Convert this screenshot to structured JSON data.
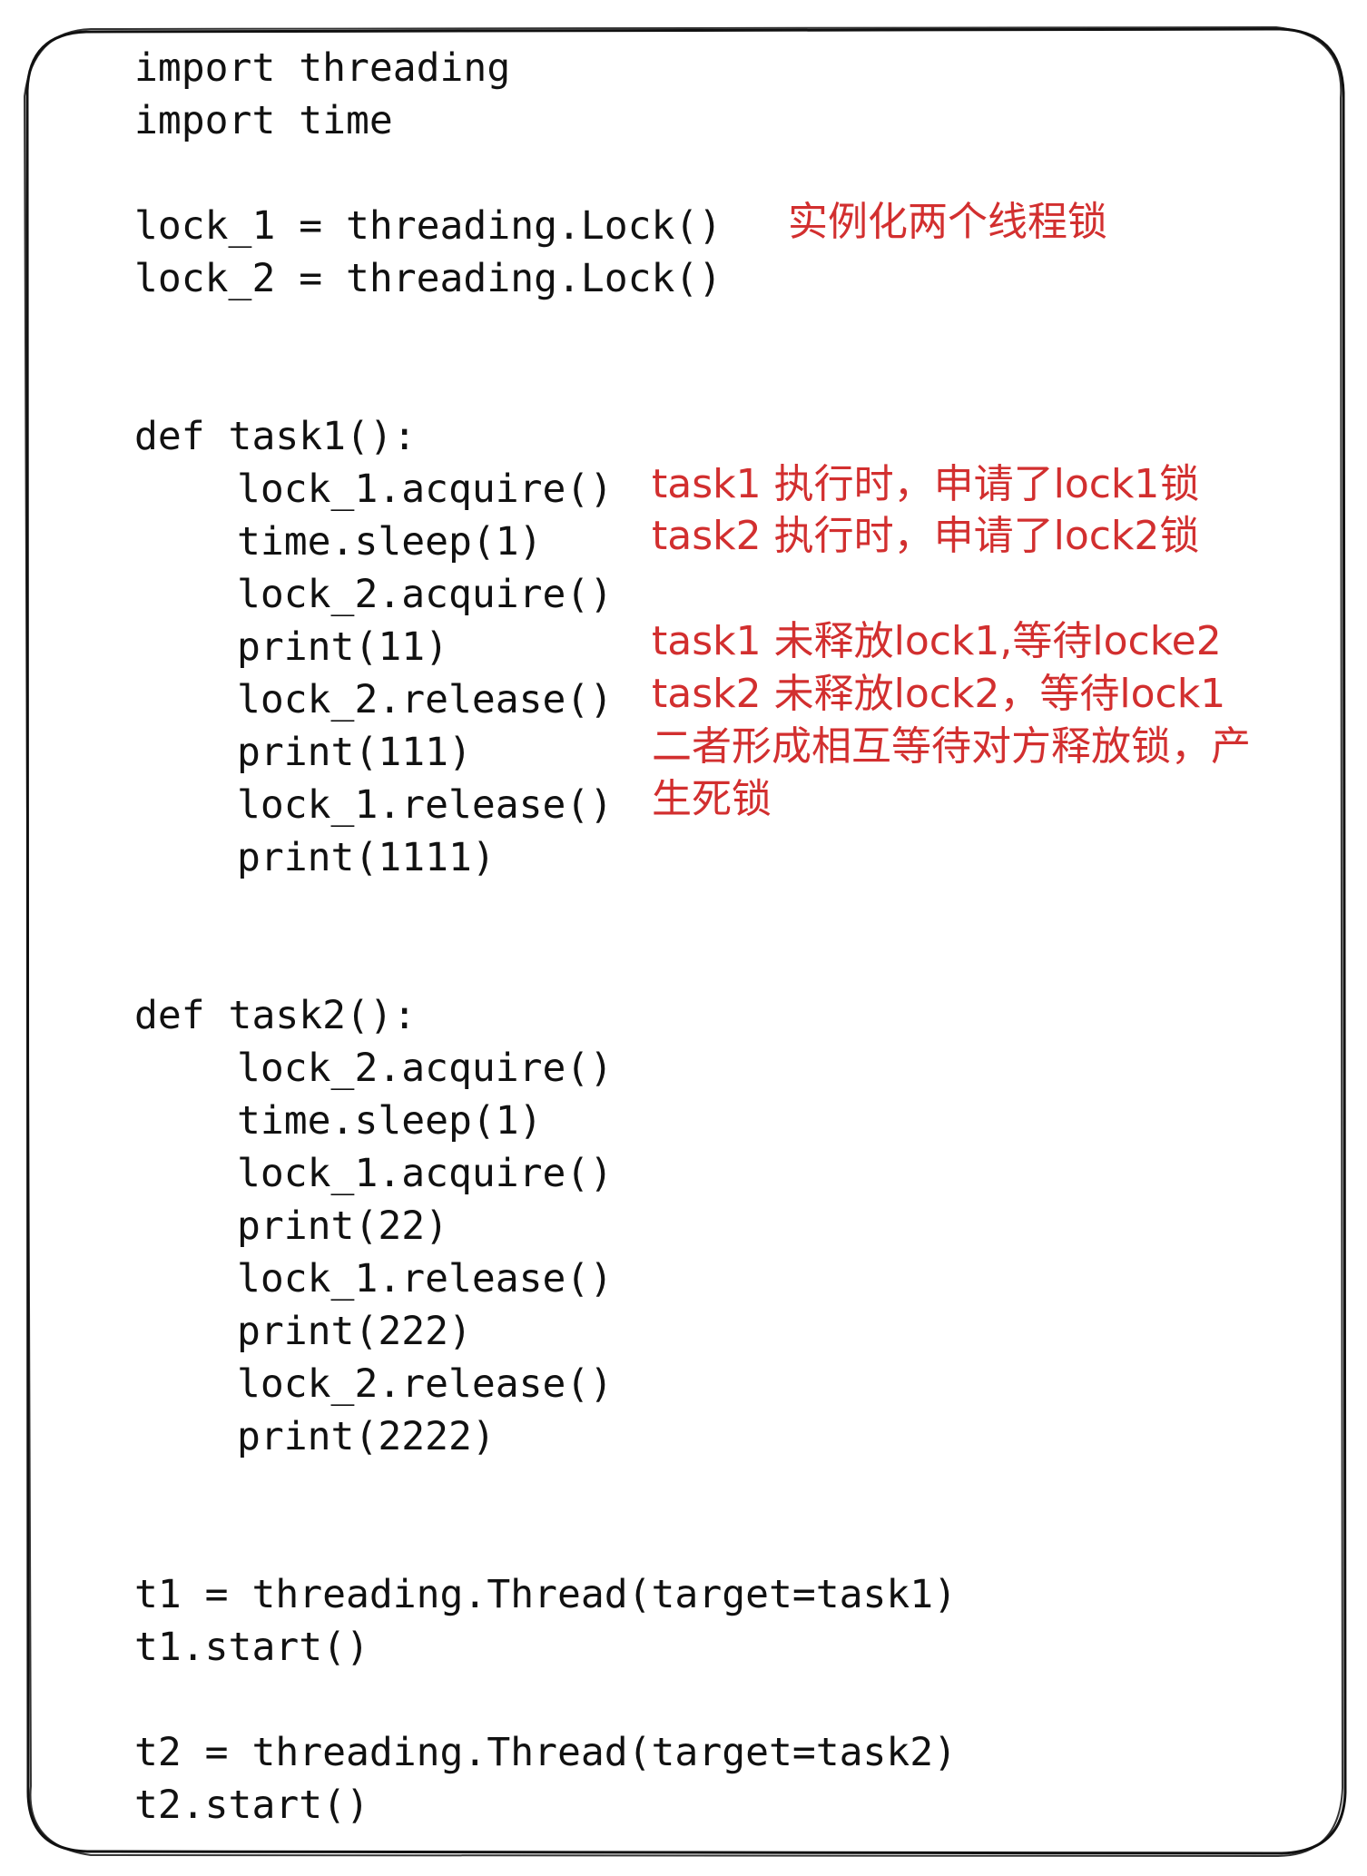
{
  "code": [
    {
      "indent": 0,
      "text": "import threading"
    },
    {
      "indent": 0,
      "text": "import time"
    },
    {
      "indent": 0,
      "text": ""
    },
    {
      "indent": 0,
      "text": "lock_1 = threading.Lock()"
    },
    {
      "indent": 0,
      "text": "lock_2 = threading.Lock()"
    },
    {
      "indent": 0,
      "text": ""
    },
    {
      "indent": 0,
      "text": ""
    },
    {
      "indent": 0,
      "text": "def task1():"
    },
    {
      "indent": 1,
      "text": "lock_1.acquire()"
    },
    {
      "indent": 1,
      "text": "time.sleep(1)"
    },
    {
      "indent": 1,
      "text": "lock_2.acquire()"
    },
    {
      "indent": 1,
      "text": "print(11)"
    },
    {
      "indent": 1,
      "text": "lock_2.release()"
    },
    {
      "indent": 1,
      "text": "print(111)"
    },
    {
      "indent": 1,
      "text": "lock_1.release()"
    },
    {
      "indent": 1,
      "text": "print(1111)"
    },
    {
      "indent": 0,
      "text": ""
    },
    {
      "indent": 0,
      "text": ""
    },
    {
      "indent": 0,
      "text": "def task2():"
    },
    {
      "indent": 1,
      "text": "lock_2.acquire()"
    },
    {
      "indent": 1,
      "text": "time.sleep(1)"
    },
    {
      "indent": 1,
      "text": "lock_1.acquire()"
    },
    {
      "indent": 1,
      "text": "print(22)"
    },
    {
      "indent": 1,
      "text": "lock_1.release()"
    },
    {
      "indent": 1,
      "text": "print(222)"
    },
    {
      "indent": 1,
      "text": "lock_2.release()"
    },
    {
      "indent": 1,
      "text": "print(2222)"
    },
    {
      "indent": 0,
      "text": ""
    },
    {
      "indent": 0,
      "text": ""
    },
    {
      "indent": 0,
      "text": "t1 = threading.Thread(target=task1)"
    },
    {
      "indent": 0,
      "text": "t1.start()"
    },
    {
      "indent": 0,
      "text": ""
    },
    {
      "indent": 0,
      "text": "t2 = threading.Thread(target=task2)"
    },
    {
      "indent": 0,
      "text": "t2.start()"
    }
  ],
  "annotations": {
    "lock_init": "实例化两个线程锁",
    "task1_acquire": "task1 执行时，申请了lock1锁",
    "task2_acquire": "task2 执行时，申请了lock2锁",
    "task1_wait": "task1 未释放lock1,等待locke2",
    "task2_wait": "task2 未释放lock2，等待lock1",
    "deadlock_line1": "二者形成相互等待对方释放锁，产",
    "deadlock_line2": "生死锁"
  },
  "colors": {
    "code_text": "#111111",
    "annotation_text": "#d22f2f",
    "frame_stroke": "#111111",
    "background": "#ffffff"
  }
}
